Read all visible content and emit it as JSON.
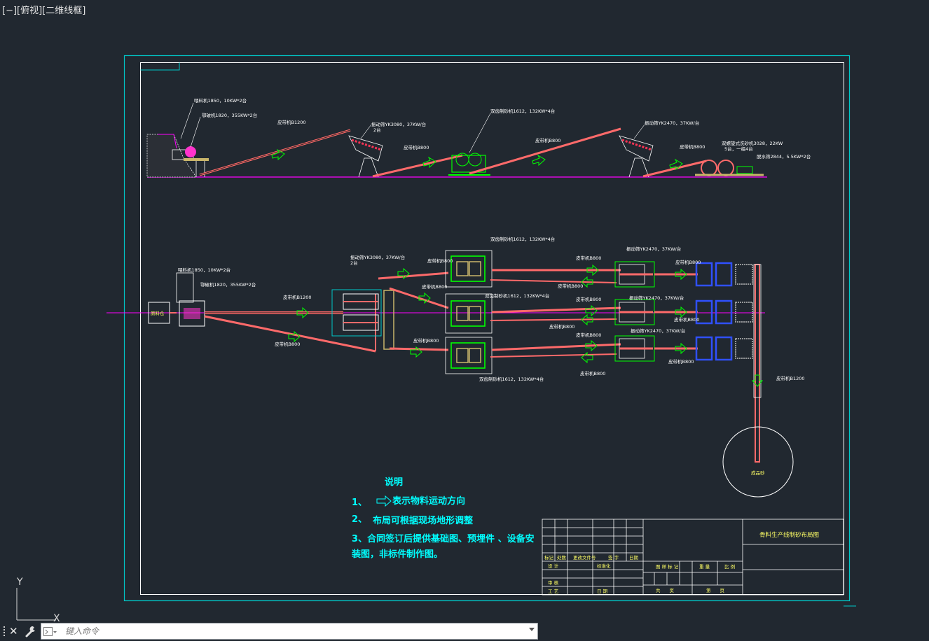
{
  "viewport": {
    "label": "[−][俯视][二维线框]"
  },
  "command": {
    "placeholder": "键入命令"
  },
  "ucs": {
    "y": "Y",
    "x": "X"
  },
  "side_view": {
    "feeder": "喂料机1850，10KW*2台",
    "jaw": "鄂破机1820，355KW*2台",
    "belt1": "皮带机B1200",
    "screen1": "振动筛YK3080，37KW/台",
    "screen1_count": "2台",
    "belt2": "皮带机B800",
    "crusher": "双齿制砂机1612，132KW*4台",
    "belt3": "皮带机B800",
    "screen2": "振动筛YK2470，37KW/台",
    "belt4": "皮带机B800",
    "washer": "双螺旋式洗砂机3028，22KW",
    "washer_count": "5台，一组4台",
    "dewater": "脱水筛2844，5.5KW*2台"
  },
  "plan_view": {
    "silo": "原料仓",
    "feeder": "喂料机1850，10KW*2台",
    "jaw": "鄂破机1820，355KW*2台",
    "belt_main": "皮带机B1200",
    "belt_lower": "皮带机B800",
    "screen": "振动筛YK3080，37KW/台",
    "screen_count": "2台",
    "belt_a": "皮带机B800",
    "belt_b": "皮带机B800",
    "belt_c": "皮带机B800",
    "crusher_top": "双齿制砂机1612，132KW*4台",
    "crusher_mid": "双齿制砂机1612，132KW*4台",
    "crusher_bot": "双齿制砂机1612，132KW*4台",
    "belt_r1": "皮带机B800",
    "belt_r2": "皮带机B800",
    "belt_r3": "皮带机B800",
    "belt_r4": "皮带机B800",
    "belt_r5": "皮带机B800",
    "belt_r6": "皮带机B800",
    "screen_r1": "振动筛YK2470，37KW/台",
    "screen_r2": "振动筛YK2470，37KW/台",
    "screen_r3": "振动筛YK2470，37KW/台",
    "belt_w1": "皮带机B800",
    "belt_w2": "皮带机B800",
    "belt_w3": "皮带机B800",
    "belt_out": "皮带机B1200",
    "product": "成品砂"
  },
  "notes": {
    "title": "说明",
    "n1_num": "1、",
    "n1_text": "表示物料运动方向",
    "n2_num": "2、",
    "n2_text": "布局可根据现场地形调整",
    "n3_line1": "3、合同签订后提供基础图、预埋件 、设备安",
    "n3_line2": "装图，非标件制作图。"
  },
  "title_block": {
    "drawing_title": "骨料生产线制砂布局图",
    "mark": "标记",
    "count": "处数",
    "file_no": "更改文件号",
    "sign": "签 字",
    "date": "日期",
    "design": "设 计",
    "standard": "标准化",
    "review": "审 核",
    "process": "工 艺",
    "approve": "日 期",
    "stage": "图 样 标 记",
    "weight": "重 量",
    "scale": "比 例",
    "total": "共　　页",
    "sheet": "第　　页"
  },
  "colors": {
    "background": "#212830",
    "frame_outer": "#00c8c8",
    "frame_inner": "#ffffff",
    "belt": "#ff6a6a",
    "equipment": "#00ff00",
    "ground": "#ff00ff",
    "notes": "#00ffff",
    "machine_blue": "#3050ff"
  }
}
